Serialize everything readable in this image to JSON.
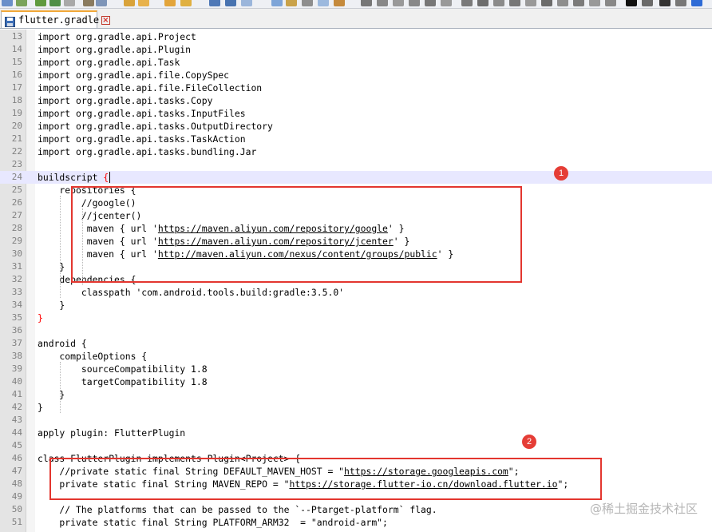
{
  "tab": {
    "title": "flutter.gradle",
    "close_glyph": "×"
  },
  "code_lines": [
    {
      "no": "13",
      "text": "import org.gradle.api.Project"
    },
    {
      "no": "14",
      "text": "import org.gradle.api.Plugin"
    },
    {
      "no": "15",
      "text": "import org.gradle.api.Task"
    },
    {
      "no": "16",
      "text": "import org.gradle.api.file.CopySpec"
    },
    {
      "no": "17",
      "text": "import org.gradle.api.file.FileCollection"
    },
    {
      "no": "18",
      "text": "import org.gradle.api.tasks.Copy"
    },
    {
      "no": "19",
      "text": "import org.gradle.api.tasks.InputFiles"
    },
    {
      "no": "20",
      "text": "import org.gradle.api.tasks.OutputDirectory"
    },
    {
      "no": "21",
      "text": "import org.gradle.api.tasks.TaskAction"
    },
    {
      "no": "22",
      "text": "import org.gradle.api.tasks.bundling.Jar"
    },
    {
      "no": "23",
      "text": ""
    },
    {
      "no": "24",
      "text": "buildscript {"
    },
    {
      "no": "25",
      "text": "    repositories {"
    },
    {
      "no": "26",
      "text": "        //google()"
    },
    {
      "no": "27",
      "text": "        //jcenter()"
    },
    {
      "no": "28",
      "text": "         maven { url 'https://maven.aliyun.com/repository/google' }"
    },
    {
      "no": "29",
      "text": "         maven { url 'https://maven.aliyun.com/repository/jcenter' }"
    },
    {
      "no": "30",
      "text": "         maven { url 'http://maven.aliyun.com/nexus/content/groups/public' }"
    },
    {
      "no": "31",
      "text": "    }"
    },
    {
      "no": "32",
      "text": "    dependencies {"
    },
    {
      "no": "33",
      "text": "        classpath 'com.android.tools.build:gradle:3.5.0'"
    },
    {
      "no": "34",
      "text": "    }"
    },
    {
      "no": "35",
      "text": "}"
    },
    {
      "no": "36",
      "text": ""
    },
    {
      "no": "37",
      "text": "android {"
    },
    {
      "no": "38",
      "text": "    compileOptions {"
    },
    {
      "no": "39",
      "text": "        sourceCompatibility 1.8"
    },
    {
      "no": "40",
      "text": "        targetCompatibility 1.8"
    },
    {
      "no": "41",
      "text": "    }"
    },
    {
      "no": "42",
      "text": "}"
    },
    {
      "no": "43",
      "text": ""
    },
    {
      "no": "44",
      "text": "apply plugin: FlutterPlugin"
    },
    {
      "no": "45",
      "text": ""
    },
    {
      "no": "46",
      "text": "class FlutterPlugin implements Plugin<Project> {"
    },
    {
      "no": "47",
      "text": "    //private static final String DEFAULT_MAVEN_HOST = \"https://storage.googleapis.com\";"
    },
    {
      "no": "48",
      "text": "    private static final String MAVEN_REPO = \"https://storage.flutter-io.cn/download.flutter.io\";"
    },
    {
      "no": "49",
      "text": ""
    },
    {
      "no": "50",
      "text": "    // The platforms that can be passed to the `--Ptarget-platform` flag."
    },
    {
      "no": "51",
      "text": "    private static final String PLATFORM_ARM32  = \"android-arm\";"
    }
  ],
  "current_line": "24",
  "annotations": [
    {
      "label": "1"
    },
    {
      "label": "2"
    }
  ],
  "watermark": "@稀土掘金技术社区",
  "colors": {
    "annotation_red": "#e3362f",
    "current_line_bg": "#e8e8ff",
    "gutter_bg": "#e4e4e4",
    "tab_accent": "#f2a838"
  },
  "icons": [
    "save-icon",
    "close-tab-icon"
  ]
}
